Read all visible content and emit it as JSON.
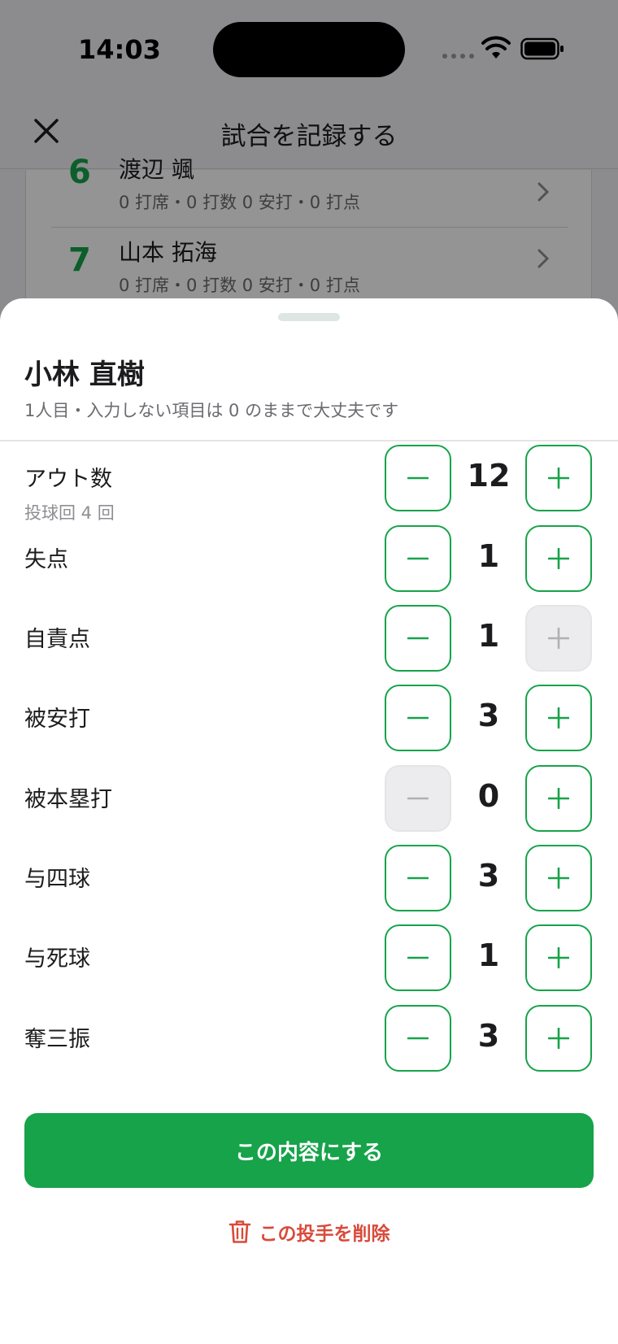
{
  "status_bar": {
    "time": "14:03"
  },
  "nav": {
    "title": "試合を記録する",
    "close_icon": "close-icon"
  },
  "background_list": [
    {
      "number": "6",
      "name": "渡辺 颯",
      "stats": "0 打席・0 打数 0 安打・0 打点"
    },
    {
      "number": "7",
      "name": "山本 拓海",
      "stats": "0 打席・0 打数 0 安打・0 打点"
    }
  ],
  "sheet": {
    "title": "小林 直樹",
    "subtitle": "1人目・入力しない項目は 0 のままで大丈夫です",
    "rows": [
      {
        "label": "アウト数",
        "sublabel": "投球回 4 回",
        "value": "12",
        "minus_enabled": true,
        "plus_enabled": true
      },
      {
        "label": "失点",
        "value": "1",
        "minus_enabled": true,
        "plus_enabled": true
      },
      {
        "label": "自責点",
        "value": "1",
        "minus_enabled": true,
        "plus_enabled": false
      },
      {
        "label": "被安打",
        "value": "3",
        "minus_enabled": true,
        "plus_enabled": true
      },
      {
        "label": "被本塁打",
        "value": "0",
        "minus_enabled": false,
        "plus_enabled": true
      },
      {
        "label": "与四球",
        "value": "3",
        "minus_enabled": true,
        "plus_enabled": true
      },
      {
        "label": "与死球",
        "value": "1",
        "minus_enabled": true,
        "plus_enabled": true
      },
      {
        "label": "奪三振",
        "value": "3",
        "minus_enabled": true,
        "plus_enabled": true
      }
    ],
    "confirm_label": "この内容にする",
    "delete_label": "この投手を削除"
  },
  "colors": {
    "accent": "#16a34a",
    "danger": "#d94a3a",
    "disabled_bg": "#ececee",
    "disabled_icon": "#b0b0b4"
  }
}
